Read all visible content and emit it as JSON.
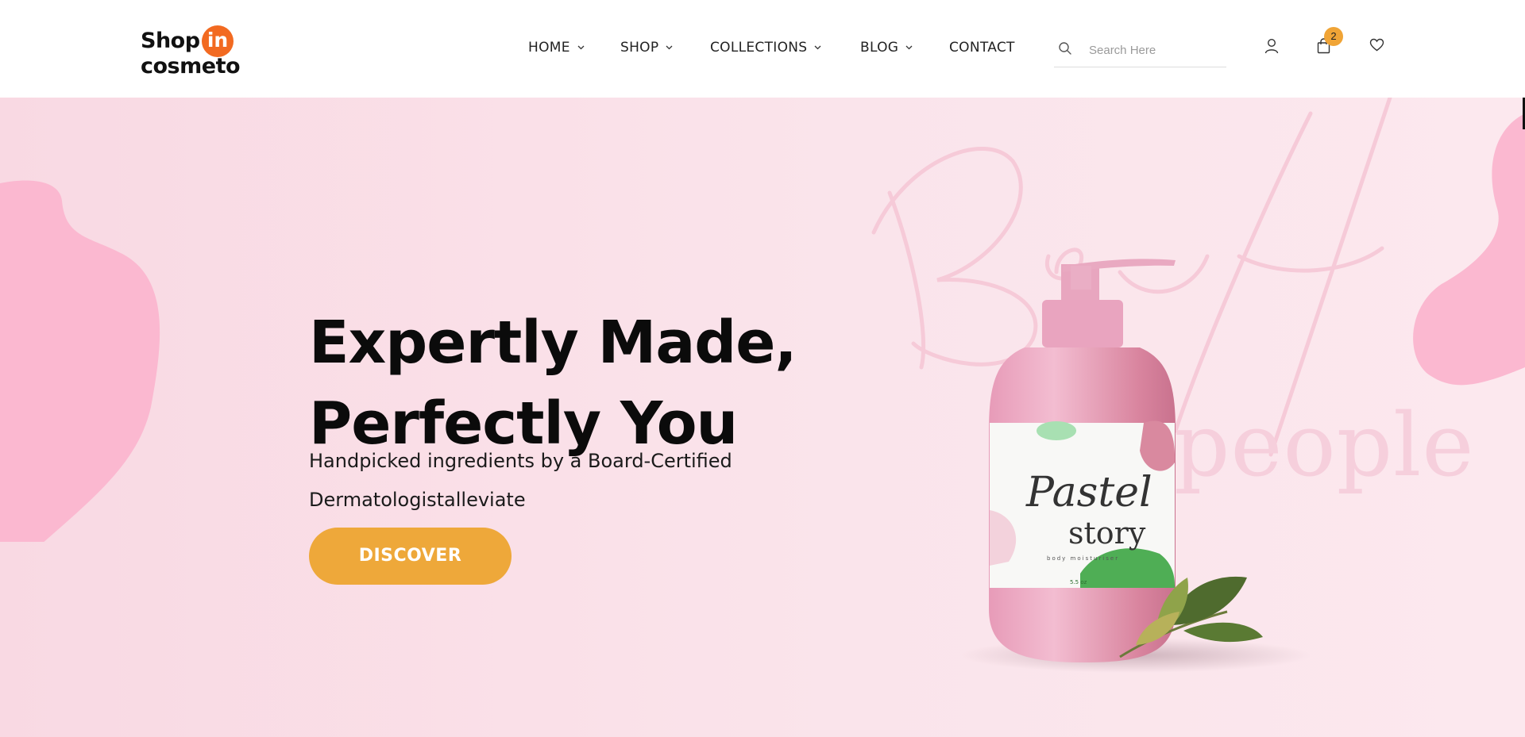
{
  "brand": {
    "word1": "Shop",
    "word2": "in",
    "word3": "cosmeto"
  },
  "nav": [
    {
      "label": "HOME",
      "has_dropdown": true
    },
    {
      "label": "SHOP",
      "has_dropdown": true
    },
    {
      "label": "COLLECTIONS",
      "has_dropdown": true
    },
    {
      "label": "BLOG",
      "has_dropdown": true
    },
    {
      "label": "CONTACT",
      "has_dropdown": false
    }
  ],
  "search": {
    "placeholder": "Search Here",
    "value": ""
  },
  "header_icons": [
    "user-icon",
    "shopping-bag-icon",
    "heart-icon"
  ],
  "cart": {
    "count": "2"
  },
  "hero": {
    "title_line1": "Expertly Made,",
    "title_line2": "Perfectly You",
    "subtitle": "Handpicked ingredients by a Board-Certified Dermatologistalleviate",
    "button_label": "DISCOVER",
    "background_script": "Beautiful",
    "background_word": "people"
  },
  "product": {
    "name_line1": "Pastel",
    "name_line2": "story",
    "tagline": "body moisturiser",
    "size": "5.5 oz"
  },
  "colors": {
    "accent_orange": "#f26a21",
    "button": "#eea83a",
    "badge": "#f0a436",
    "hero_bg": "#fae4eb",
    "blob_pink": "#fbb8d0"
  }
}
